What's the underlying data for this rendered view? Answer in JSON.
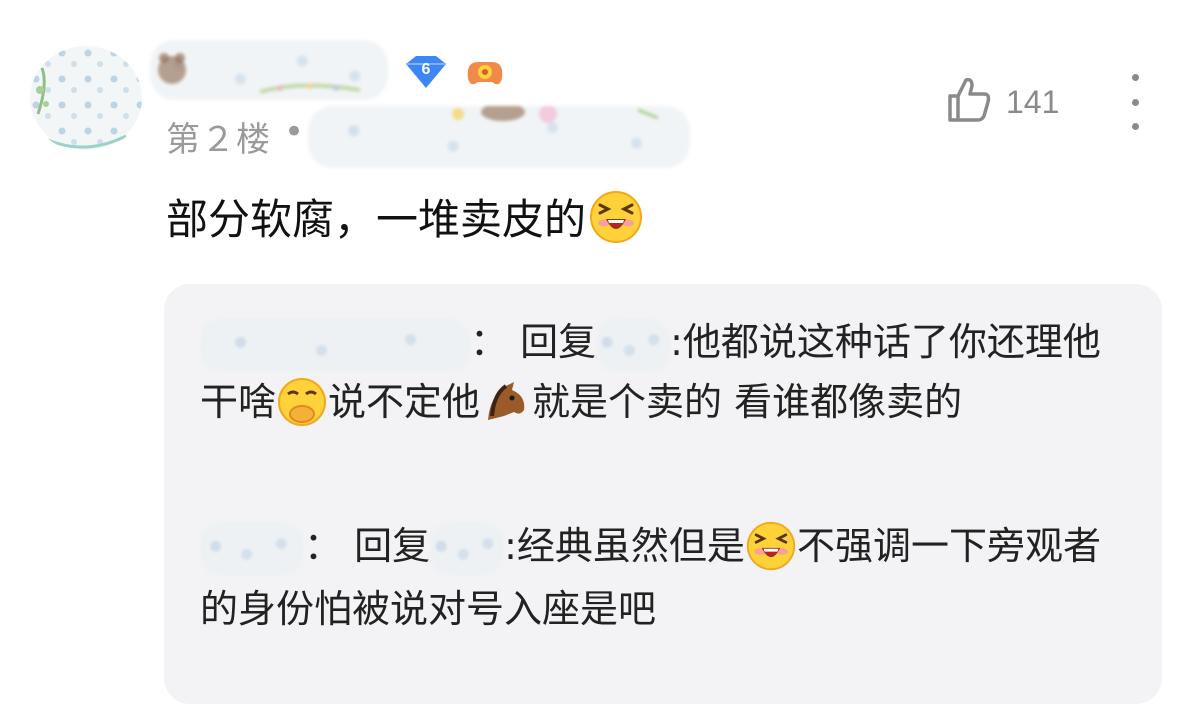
{
  "comment": {
    "floor_label": "第２楼",
    "separator": "•",
    "like_count": "141",
    "text": "部分软腐，一堆卖皮的",
    "badge_level": "6",
    "icons": {
      "like": "thumbs-up-icon",
      "more": "more-vertical-icon",
      "emoji_laugh": "laughing-emoji-icon",
      "emoji_cover_mouth": "cover-mouth-emoji-icon",
      "emoji_horse": "horse-emoji-icon"
    }
  },
  "replies": [
    {
      "reply_label": "回复",
      "colon": "：",
      "text_part1": ":他都说这种话了你还理他干啥",
      "text_part2": "说不定他",
      "text_part3": "就是个卖的 看谁都像卖的"
    },
    {
      "reply_label": "回复",
      "colon": "：",
      "text_part1": ":经典虽然但是",
      "text_part2": "不强调一下旁观者的身份怕被说对号入座是吧"
    }
  ],
  "colors": {
    "reply_bg": "#f3f3f5",
    "muted": "#9a9a9a",
    "text": "#111111"
  }
}
